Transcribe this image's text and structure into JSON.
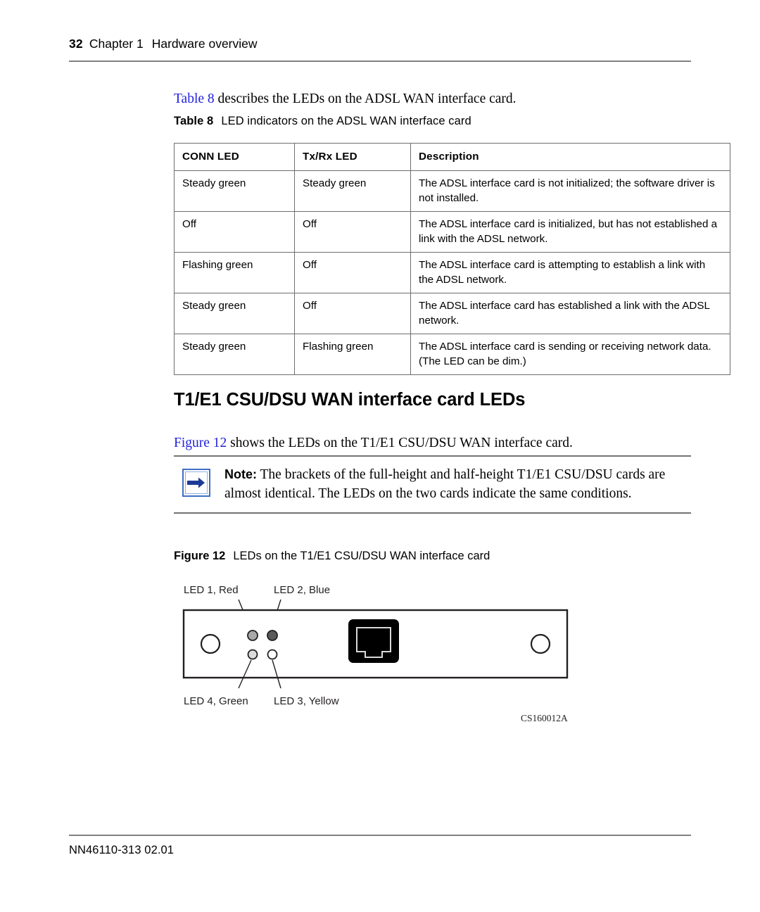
{
  "header": {
    "page_number": "32",
    "chapter": "Chapter 1",
    "title": "Hardware overview"
  },
  "intro": {
    "xref": "Table 8",
    "rest": " describes the LEDs on the ADSL WAN interface card."
  },
  "table_caption": {
    "label": "Table 8",
    "text": "LED indicators on the ADSL WAN interface card"
  },
  "table": {
    "columns": [
      "CONN LED",
      "Tx/Rx LED",
      "Description"
    ],
    "rows": [
      {
        "conn": "Steady green",
        "txrx": "Steady green",
        "description": "The ADSL interface card is not initialized; the software driver is not installed."
      },
      {
        "conn": "Off",
        "txrx": "Off",
        "description": "The ADSL interface card is initialized, but has not established a link with the ADSL network."
      },
      {
        "conn": "Flashing green",
        "txrx": "Off",
        "description": "The ADSL interface card is attempting to establish a link with the ADSL network."
      },
      {
        "conn": "Steady green",
        "txrx": "Off",
        "description": "The ADSL interface card has established a link with the ADSL network."
      },
      {
        "conn": "Steady green",
        "txrx": "Flashing green",
        "description": "The ADSL interface card is sending or receiving network data. (The LED can be dim.)"
      }
    ]
  },
  "section": {
    "heading": "T1/E1 CSU/DSU WAN interface card LEDs"
  },
  "figure_intro": {
    "xref": "Figure 12",
    "rest": " shows the LEDs on the T1/E1 CSU/DSU WAN interface card."
  },
  "note": {
    "label": "Note:",
    "text": " The brackets of the full-height and half-height T1/E1 CSU/DSU cards are almost identical. The LEDs on the two cards indicate the same conditions.",
    "icon": "arrow-right-icon",
    "icon_color": "#1b3c96",
    "border_color": "#3f6fc4"
  },
  "figure_caption": {
    "label": "Figure 12",
    "text": "LEDs on the T1/E1 CSU/DSU WAN interface card"
  },
  "figure": {
    "labels": {
      "led1": "LED 1, Red",
      "led2": "LED 2, Blue",
      "led3": "LED 3, Yellow",
      "led4": "LED 4, Green"
    },
    "figure_id": "CS160012A",
    "led_fills": {
      "led1": "#a8a8a8",
      "led2": "#5a5a5a",
      "led3": "#ffffff",
      "led4": "#dcdcdc"
    },
    "jack_color": "#000000"
  },
  "footer": {
    "text": "NN46110-313 02.01"
  },
  "colors": {
    "xref_blue": "#2222dd",
    "rule_gray": "#808080",
    "table_border": "#6d6d6d"
  }
}
